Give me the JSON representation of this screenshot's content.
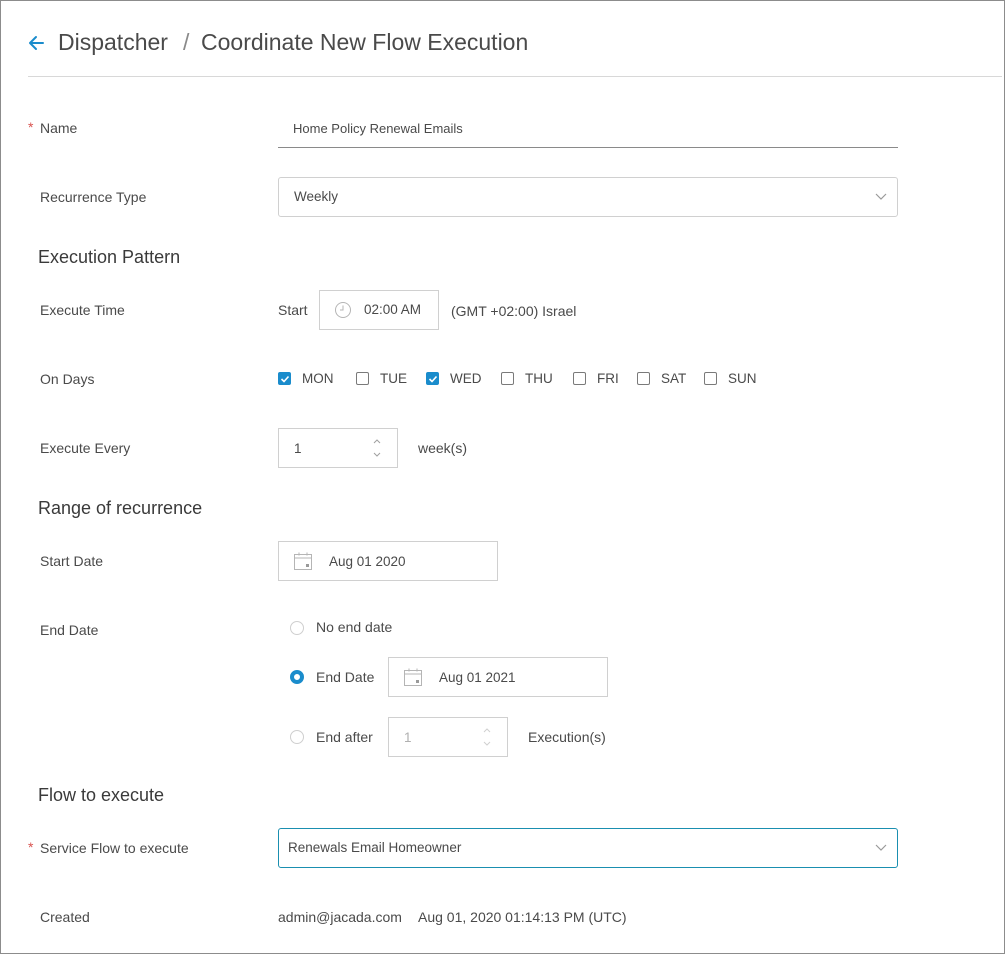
{
  "header": {
    "back_icon": "arrow-left-icon",
    "breadcrumb_parent": "Dispatcher",
    "separator": "/",
    "title": "Coordinate New Flow Execution"
  },
  "fields": {
    "name": {
      "label": "Name",
      "value": "Home Policy Renewal Emails"
    },
    "recurrence_type": {
      "label": "Recurrence Type",
      "value": "Weekly"
    },
    "service_flow": {
      "label": "Service Flow to execute",
      "value": "Renewals Email Homeowner"
    }
  },
  "sections": {
    "execution_pattern": "Execution Pattern",
    "range_of_recurrence": "Range of recurrence",
    "flow_to_execute": "Flow to execute"
  },
  "execute_time": {
    "label": "Execute Time",
    "start_label": "Start",
    "time": "02:00 AM",
    "timezone": "(GMT +02:00) Israel"
  },
  "on_days": {
    "label": "On Days",
    "days": [
      {
        "label": "MON",
        "checked": true
      },
      {
        "label": "TUE",
        "checked": false
      },
      {
        "label": "WED",
        "checked": true
      },
      {
        "label": "THU",
        "checked": false
      },
      {
        "label": "FRI",
        "checked": false
      },
      {
        "label": "SAT",
        "checked": false
      },
      {
        "label": "SUN",
        "checked": false
      }
    ]
  },
  "execute_every": {
    "label": "Execute Every",
    "value": "1",
    "unit": "week(s)"
  },
  "start_date": {
    "label": "Start Date",
    "value": "Aug 01 2020"
  },
  "end_date": {
    "label": "End Date",
    "selected": "end_date",
    "options": {
      "no_end": "No end date",
      "end_date": "End Date",
      "end_after": "End after"
    },
    "end_date_value": "Aug 01 2021",
    "end_after_value": "1",
    "end_after_unit": "Execution(s)"
  },
  "created": {
    "label": "Created",
    "user": "admin@jacada.com",
    "timestamp": "Aug 01, 2020 01:14:13 PM (UTC)"
  },
  "colors": {
    "accent": "#1a8ccc",
    "required": "#d9534f",
    "focus_border": "#1a8fb0"
  }
}
